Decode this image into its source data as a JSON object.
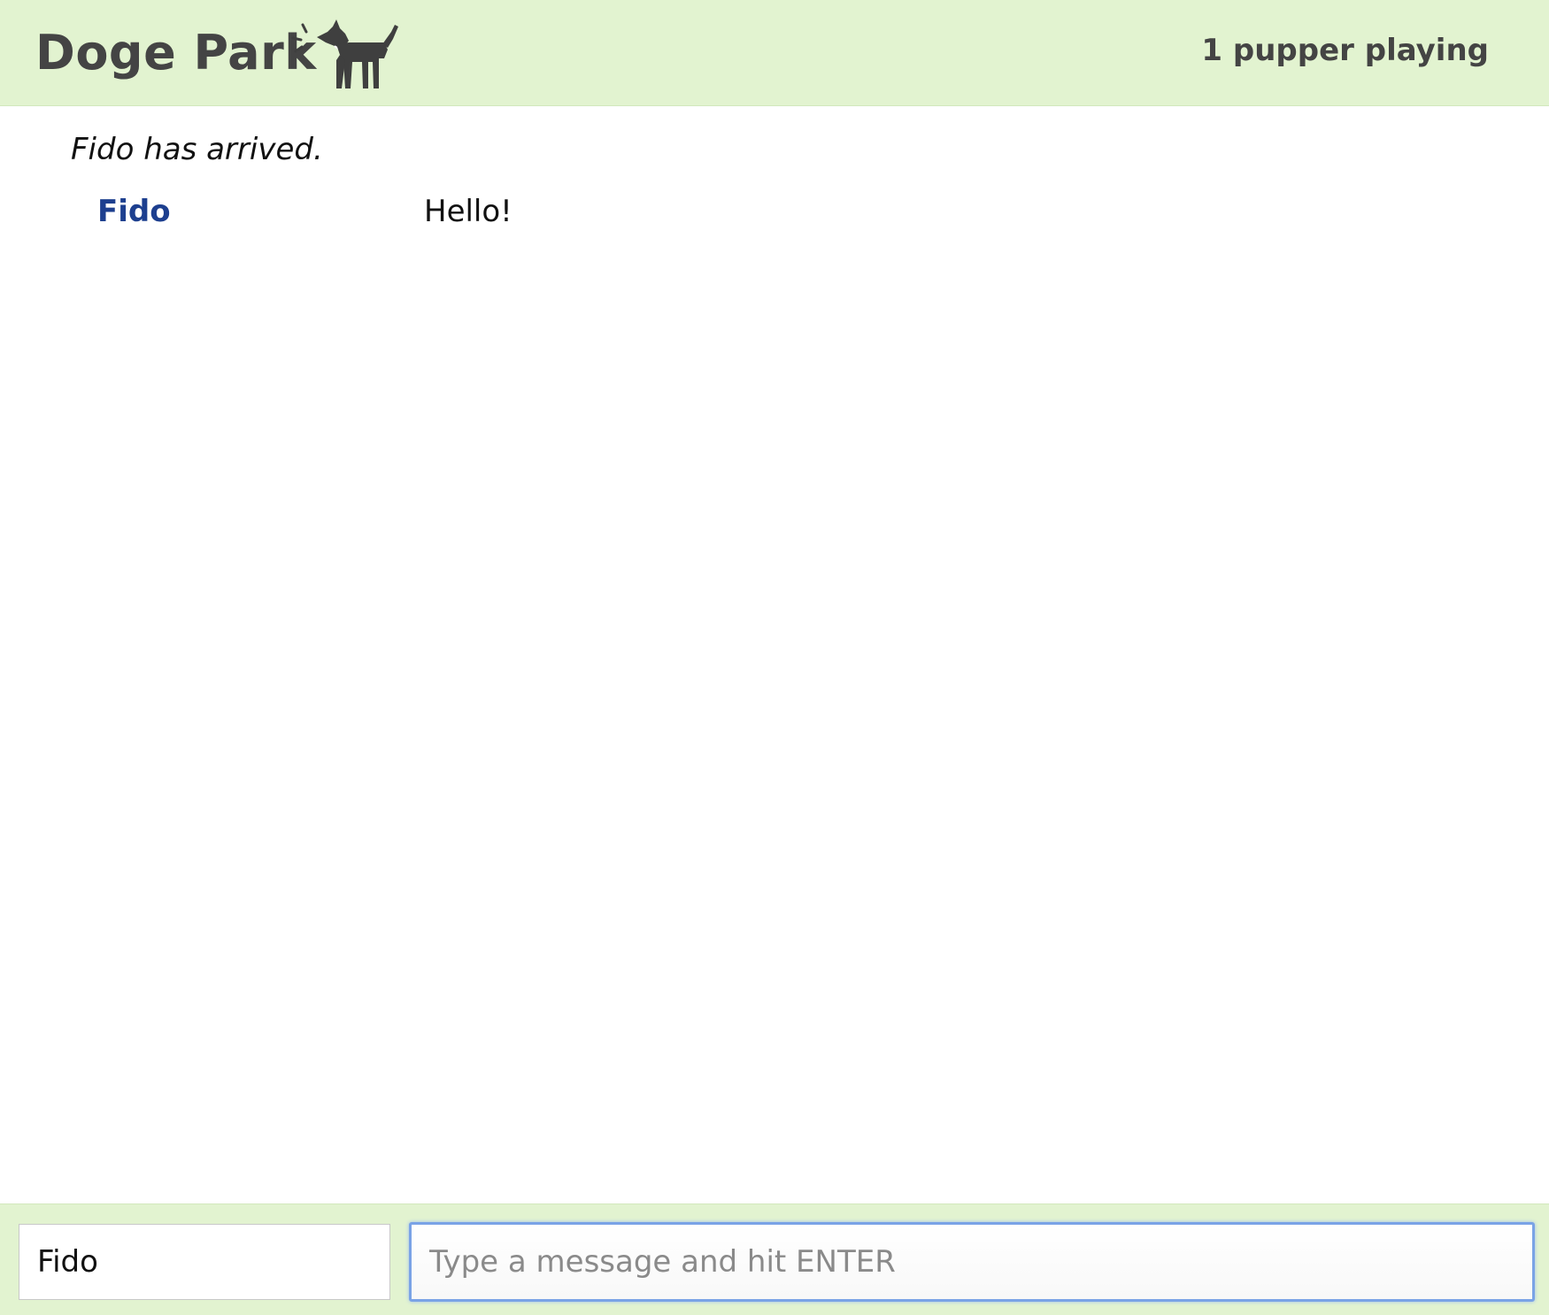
{
  "header": {
    "title": "Doge Park",
    "icon": "barking-dog-icon",
    "player_count": "1 pupper playing",
    "background_color": "#e2f3d0"
  },
  "messages": {
    "system": "Fido has arrived.",
    "chat": [
      {
        "author": "Fido",
        "text": "Hello!"
      }
    ],
    "author_color": "#1d3f8f"
  },
  "footer": {
    "name_value": "Fido",
    "message_placeholder": "Type a message and hit ENTER",
    "focus_color": "#7aa3e6"
  }
}
